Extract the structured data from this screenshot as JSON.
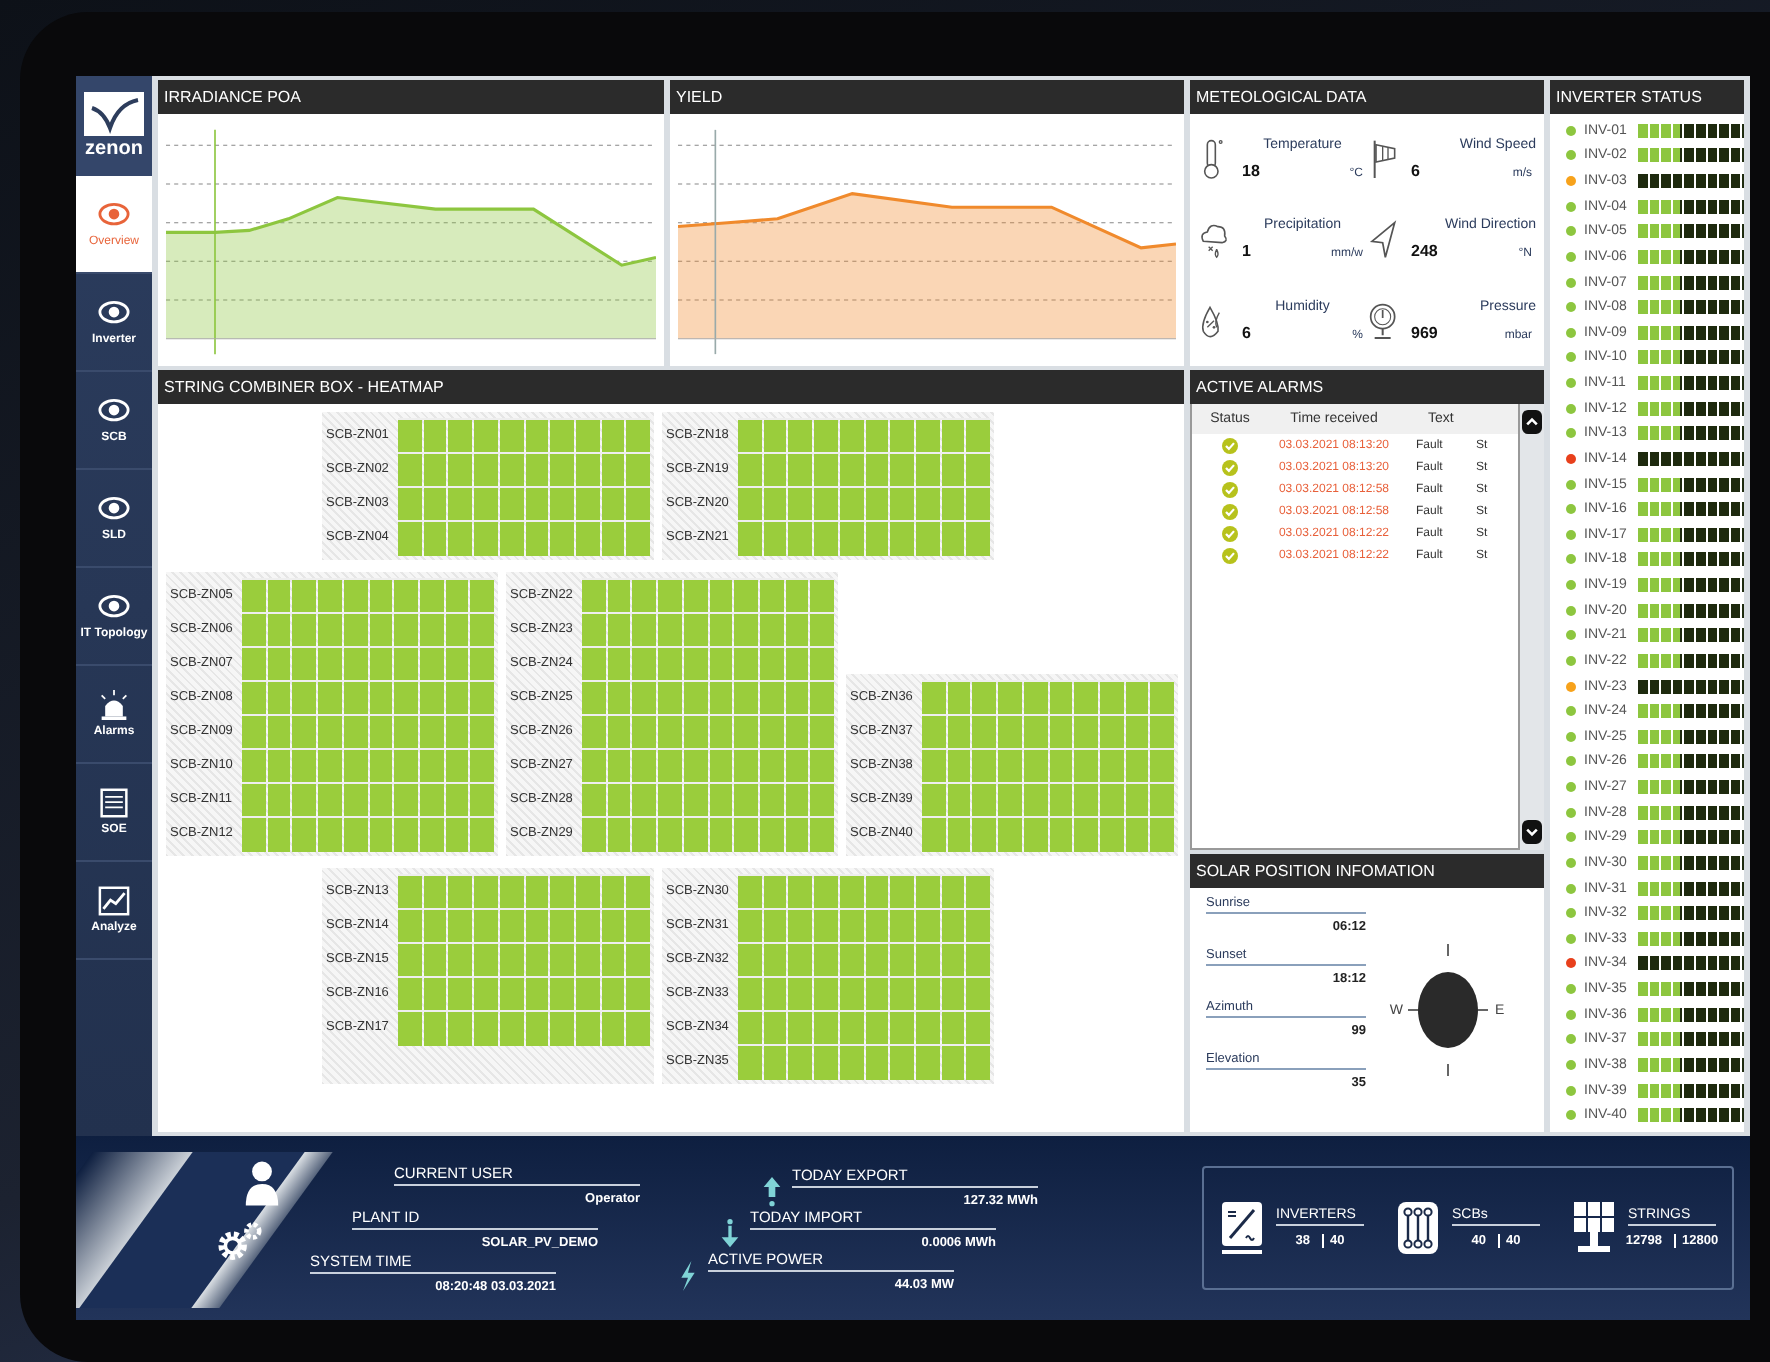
{
  "sidebar": {
    "logo": "zenon",
    "items": [
      {
        "kind": "eye",
        "label": "Overview",
        "selected": true
      },
      {
        "kind": "eye",
        "label": "Inverter",
        "selected": false
      },
      {
        "kind": "eye",
        "label": "SCB",
        "selected": false
      },
      {
        "kind": "eye",
        "label": "SLD",
        "selected": false
      },
      {
        "kind": "eye",
        "label": "IT Topology",
        "selected": false
      },
      {
        "kind": "alarm",
        "label": "Alarms",
        "selected": false
      },
      {
        "kind": "list",
        "label": "SOE",
        "selected": false
      },
      {
        "kind": "chart",
        "label": "Analyze",
        "selected": false
      }
    ]
  },
  "charts": [
    {
      "title": "IRRADIANCE POA",
      "color": "#8dc63f"
    },
    {
      "title": "YIELD",
      "color": "#f08a2c"
    }
  ],
  "meteo": {
    "title": "METEOLOGICAL DATA",
    "items": [
      {
        "kind": "temperature",
        "label": "Temperature",
        "value": "18",
        "unit": "°C"
      },
      {
        "kind": "wind_speed",
        "label": "Wind Speed",
        "value": "6",
        "unit": "m/s"
      },
      {
        "kind": "precipitation",
        "label": "Precipitation",
        "value": "1",
        "unit": "mm/w"
      },
      {
        "kind": "wind_direction",
        "label": "Wind Direction",
        "value": "248",
        "unit": "°N"
      },
      {
        "kind": "humidity",
        "label": "Humidity",
        "value": "6",
        "unit": "%"
      },
      {
        "kind": "pressure",
        "label": "Pressure",
        "value": "969",
        "unit": "mbar"
      }
    ]
  },
  "heatmap": {
    "title": "STRING COMBINER BOX - HEATMAP",
    "rows": [
      {
        "groups": [
          {
            "boxes": [
              "SCB-ZN01",
              "SCB-ZN02",
              "SCB-ZN03",
              "SCB-ZN04"
            ]
          },
          {
            "boxes": [
              "SCB-ZN18",
              "SCB-ZN19",
              "SCB-ZN20",
              "SCB-ZN21"
            ]
          }
        ]
      },
      {
        "groups": [
          {
            "boxes": [
              "SCB-ZN05",
              "SCB-ZN06",
              "SCB-ZN07",
              "SCB-ZN08",
              "SCB-ZN09",
              "SCB-ZN10",
              "SCB-ZN11",
              "SCB-ZN12"
            ]
          },
          {
            "boxes": [
              "SCB-ZN22",
              "SCB-ZN23",
              "SCB-ZN24",
              "SCB-ZN25",
              "SCB-ZN26",
              "SCB-ZN27",
              "SCB-ZN28",
              "SCB-ZN29"
            ]
          },
          {
            "boxes": [
              "SCB-ZN36",
              "SCB-ZN37",
              "SCB-ZN38",
              "SCB-ZN39",
              "SCB-ZN40"
            ]
          }
        ]
      },
      {
        "groups": [
          {
            "boxes": [
              "SCB-ZN13",
              "SCB-ZN14",
              "SCB-ZN15",
              "SCB-ZN16",
              "SCB-ZN17"
            ]
          },
          {
            "boxes": [
              "SCB-ZN30",
              "SCB-ZN31",
              "SCB-ZN32",
              "SCB-ZN33",
              "SCB-ZN34",
              "SCB-ZN35"
            ]
          }
        ]
      }
    ]
  },
  "alarms": {
    "title": "ACTIVE ALARMS",
    "columns": [
      "Status",
      "Time received",
      "Text"
    ],
    "rows": [
      {
        "time": "03.03.2021 08:13:20",
        "text": "Fault",
        "column_4": "St"
      },
      {
        "time": "03.03.2021 08:13:20",
        "text": "Fault",
        "column_4": "St"
      },
      {
        "time": "03.03.2021 08:12:58",
        "text": "Fault",
        "column_4": "St"
      },
      {
        "time": "03.03.2021 08:12:58",
        "text": "Fault",
        "column_4": "St"
      },
      {
        "time": "03.03.2021 08:12:22",
        "text": "Fault",
        "column_4": "St"
      },
      {
        "time": "03.03.2021 08:12:22",
        "text": "Fault",
        "column_4": "St"
      }
    ]
  },
  "solar": {
    "title": "SOLAR POSITION INFOMATION",
    "items": [
      {
        "label": "Sunrise",
        "value": "06:12"
      },
      {
        "label": "Sunset",
        "value": "18:12"
      },
      {
        "label": "Azimuth",
        "value": "99"
      },
      {
        "label": "Elevation",
        "value": "35"
      }
    ],
    "west": "W",
    "east": "E"
  },
  "inverters": {
    "title": "INVERTER STATUS",
    "items": [
      {
        "name": "INV-01",
        "color": "#8dc63f",
        "level": 0.4
      },
      {
        "name": "INV-02",
        "color": "#8dc63f",
        "level": 0.4
      },
      {
        "name": "INV-03",
        "color": "#f7a21b",
        "level": 0
      },
      {
        "name": "INV-04",
        "color": "#8dc63f",
        "level": 0.4
      },
      {
        "name": "INV-05",
        "color": "#8dc63f",
        "level": 0.4
      },
      {
        "name": "INV-06",
        "color": "#8dc63f",
        "level": 0.4
      },
      {
        "name": "INV-07",
        "color": "#8dc63f",
        "level": 0.4
      },
      {
        "name": "INV-08",
        "color": "#8dc63f",
        "level": 0.4
      },
      {
        "name": "INV-09",
        "color": "#8dc63f",
        "level": 0.4
      },
      {
        "name": "INV-10",
        "color": "#8dc63f",
        "level": 0.4
      },
      {
        "name": "INV-11",
        "color": "#8dc63f",
        "level": 0.4
      },
      {
        "name": "INV-12",
        "color": "#8dc63f",
        "level": 0.4
      },
      {
        "name": "INV-13",
        "color": "#8dc63f",
        "level": 0.4
      },
      {
        "name": "INV-14",
        "color": "#e8401c",
        "level": 0
      },
      {
        "name": "INV-15",
        "color": "#8dc63f",
        "level": 0.4
      },
      {
        "name": "INV-16",
        "color": "#8dc63f",
        "level": 0.4
      },
      {
        "name": "INV-17",
        "color": "#8dc63f",
        "level": 0.4
      },
      {
        "name": "INV-18",
        "color": "#8dc63f",
        "level": 0.4
      },
      {
        "name": "INV-19",
        "color": "#8dc63f",
        "level": 0.4
      },
      {
        "name": "INV-20",
        "color": "#8dc63f",
        "level": 0.4
      },
      {
        "name": "INV-21",
        "color": "#8dc63f",
        "level": 0.4
      },
      {
        "name": "INV-22",
        "color": "#8dc63f",
        "level": 0.4
      },
      {
        "name": "INV-23",
        "color": "#f7a21b",
        "level": 0
      },
      {
        "name": "INV-24",
        "color": "#8dc63f",
        "level": 0.4
      },
      {
        "name": "INV-25",
        "color": "#8dc63f",
        "level": 0.4
      },
      {
        "name": "INV-26",
        "color": "#8dc63f",
        "level": 0.4
      },
      {
        "name": "INV-27",
        "color": "#8dc63f",
        "level": 0.4
      },
      {
        "name": "INV-28",
        "color": "#8dc63f",
        "level": 0.4
      },
      {
        "name": "INV-29",
        "color": "#8dc63f",
        "level": 0.4
      },
      {
        "name": "INV-30",
        "color": "#8dc63f",
        "level": 0.4
      },
      {
        "name": "INV-31",
        "color": "#8dc63f",
        "level": 0.4
      },
      {
        "name": "INV-32",
        "color": "#8dc63f",
        "level": 0.4
      },
      {
        "name": "INV-33",
        "color": "#8dc63f",
        "level": 0.4
      },
      {
        "name": "INV-34",
        "color": "#e8401c",
        "level": 0
      },
      {
        "name": "INV-35",
        "color": "#8dc63f",
        "level": 0.4
      },
      {
        "name": "INV-36",
        "color": "#8dc63f",
        "level": 0.4
      },
      {
        "name": "INV-37",
        "color": "#8dc63f",
        "level": 0.4
      },
      {
        "name": "INV-38",
        "color": "#8dc63f",
        "level": 0.4
      },
      {
        "name": "INV-39",
        "color": "#8dc63f",
        "level": 0.4
      },
      {
        "name": "INV-40",
        "color": "#8dc63f",
        "level": 0.4
      }
    ]
  },
  "footer": {
    "info": [
      {
        "label": "CURRENT USER",
        "value": "Operator"
      },
      {
        "label": "PLANT ID",
        "value": "SOLAR_PV_DEMO"
      },
      {
        "label": "SYSTEM TIME",
        "value": "08:20:48 03.03.2021"
      }
    ],
    "energy": [
      {
        "kind": "export",
        "label": "TODAY EXPORT",
        "value": "127.32 MWh"
      },
      {
        "kind": "import",
        "label": "TODAY IMPORT",
        "value": "0.0006 MWh"
      },
      {
        "kind": "power",
        "label": "ACTIVE POWER",
        "value": "44.03 MW"
      }
    ],
    "counts": [
      {
        "kind": "inverters",
        "label": "INVERTERS",
        "value": "38",
        "total": "40"
      },
      {
        "kind": "scbs",
        "label": "SCBs",
        "value": "40",
        "total": "40"
      },
      {
        "kind": "strings",
        "label": "STRINGS",
        "value": "12798",
        "total": "12800"
      }
    ]
  }
}
